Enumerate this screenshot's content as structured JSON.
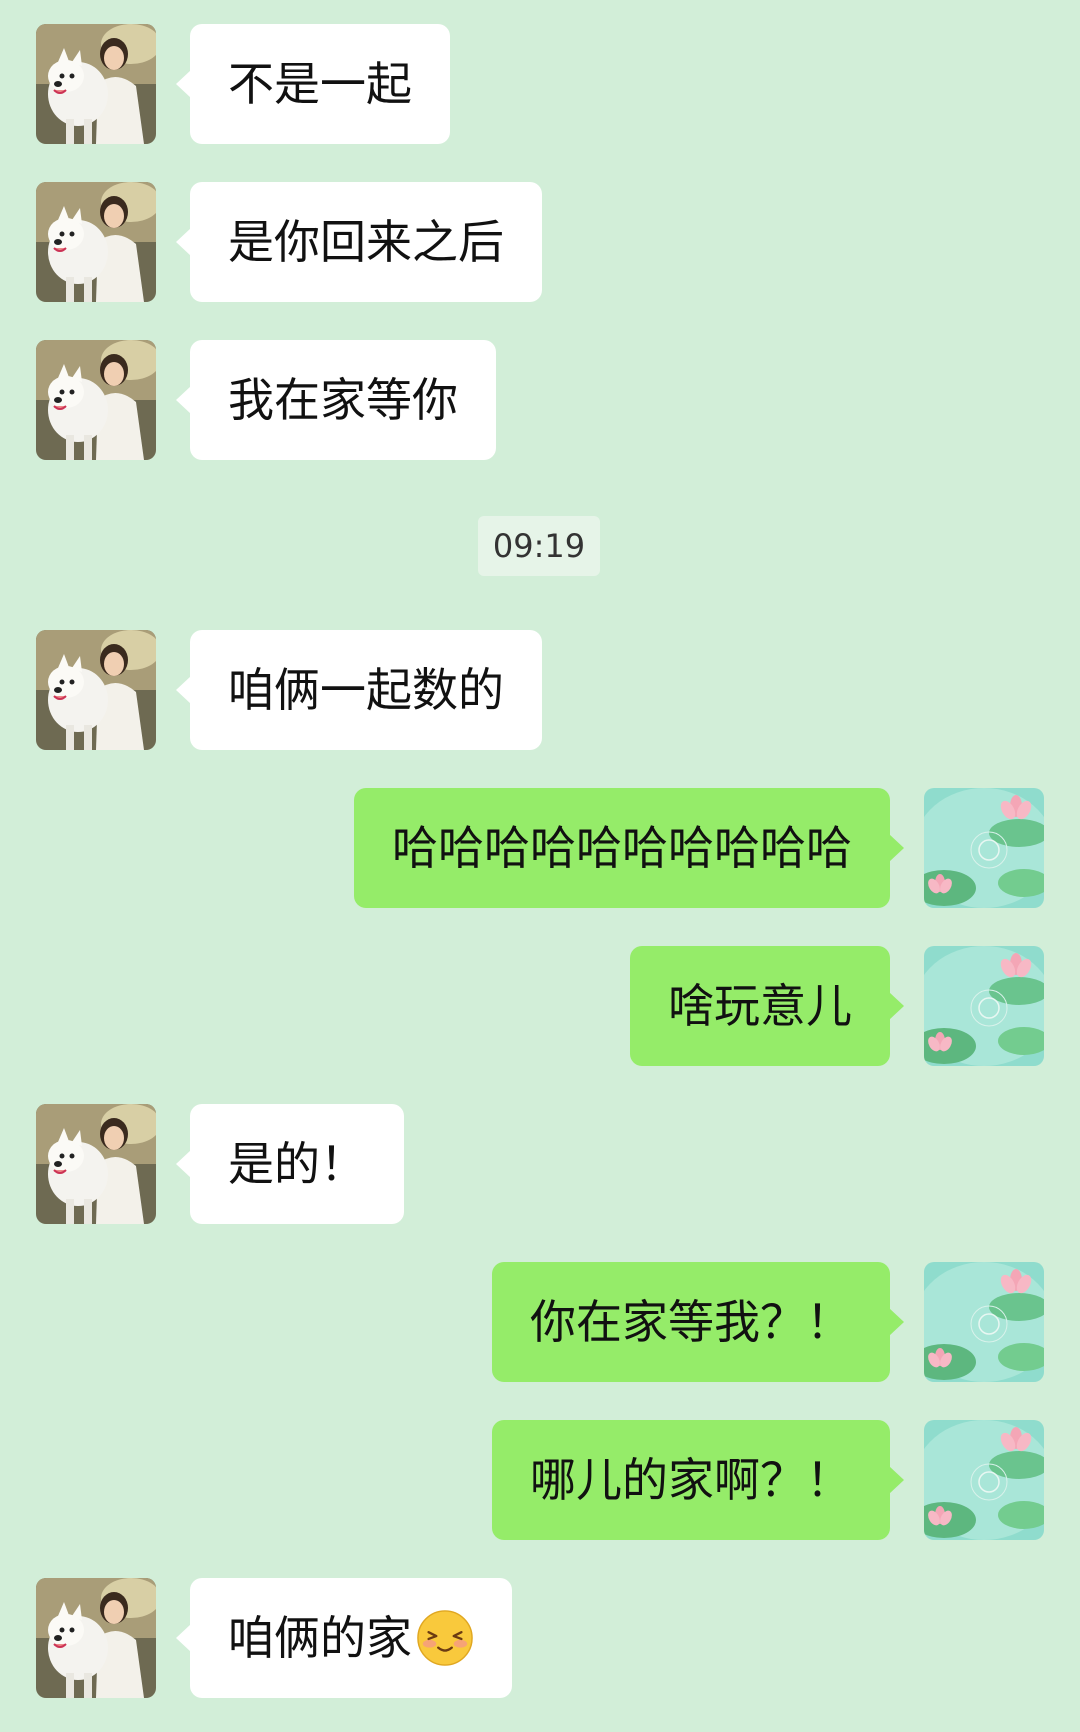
{
  "chat": {
    "timestamp": "09:19",
    "messages": [
      {
        "side": "in",
        "text": "不是一起"
      },
      {
        "side": "in",
        "text": "是你回来之后"
      },
      {
        "side": "in",
        "text": "我在家等你"
      },
      {
        "side": "in",
        "text": "咱俩一起数的"
      },
      {
        "side": "out",
        "text": "哈哈哈哈哈哈哈哈哈哈"
      },
      {
        "side": "out",
        "text": "啥玩意儿"
      },
      {
        "side": "in",
        "text": "是的！"
      },
      {
        "side": "out",
        "text": "你在家等我？！"
      },
      {
        "side": "out",
        "text": "哪儿的家啊？！"
      },
      {
        "side": "in",
        "text": "咱俩的家",
        "emoji": "shy-smile-emoji"
      }
    ]
  },
  "colors": {
    "background": "#d2eed8",
    "incoming_bubble": "#ffffff",
    "outgoing_bubble": "#95ec69"
  },
  "icons": {
    "contact_avatar": "girl-with-white-dog-avatar",
    "my_avatar": "lotus-pond-avatar"
  }
}
